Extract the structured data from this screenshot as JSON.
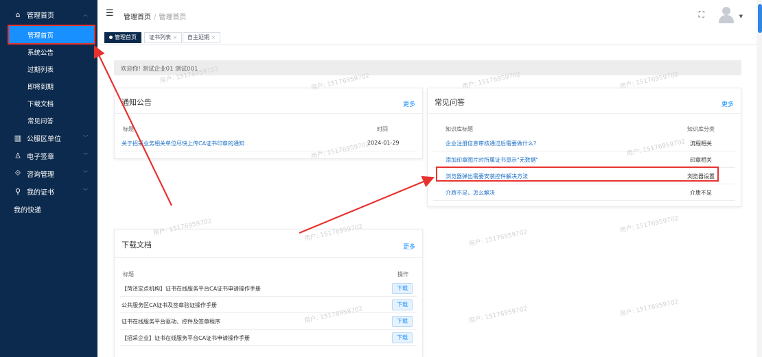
{
  "sidebar": {
    "groups": [
      {
        "label": "管理首页",
        "icon": "home-icon",
        "expanded": true,
        "items": [
          {
            "label": "管理首页",
            "active": true
          },
          {
            "label": "系统公告"
          },
          {
            "label": "过期列表"
          },
          {
            "label": "即将到期"
          },
          {
            "label": "下载文档"
          },
          {
            "label": "常见问答"
          }
        ]
      },
      {
        "label": "公服区单位",
        "icon": "building-icon"
      },
      {
        "label": "电子签章",
        "icon": "person-stamp-icon"
      },
      {
        "label": "咨询管理",
        "icon": "consult-icon"
      },
      {
        "label": "我的证书",
        "icon": "user-icon"
      }
    ],
    "leaf": {
      "label": "我的快递"
    }
  },
  "header": {
    "breadcrumb": [
      "管理首页",
      "管理首页"
    ]
  },
  "tags": [
    {
      "label": "管理首页",
      "active": true
    },
    {
      "label": "证书列表"
    },
    {
      "label": "自主延期"
    }
  ],
  "welcome": "欢迎你!  测试企业01 测试001",
  "watermark": "用户: 15176959702",
  "notice": {
    "title": "通知公告",
    "more": "更多",
    "headers": [
      "标题",
      "时间"
    ],
    "rows": [
      {
        "title": "关于招采业务相关单位尽快上传CA证书印章的通知",
        "date": "2024-01-29"
      }
    ]
  },
  "faq": {
    "title": "常见问答",
    "more": "更多",
    "headers": [
      "知识库标题",
      "知识库分类"
    ],
    "rows": [
      {
        "title": "企业注册信息审核通过后需要做什么?",
        "category": "流程相关"
      },
      {
        "title": "添加印章图片时所属证书显示\"无数据\"",
        "category": "印章相关"
      },
      {
        "title": "浏览器弹出需要安装控件解决方法",
        "category": "浏览器设置",
        "highlighted": true
      },
      {
        "title": "介质不足，怎么解决",
        "category": "介质不足"
      }
    ]
  },
  "downloads": {
    "title": "下载文档",
    "more": "更多",
    "headers": [
      "标题",
      "操作"
    ],
    "button_label": "下载",
    "rows": [
      {
        "title": "【菏泽定点机构】证书在线服务平台CA证书申请操作手册"
      },
      {
        "title": "公共服务区CA证书及签章验证操作手册"
      },
      {
        "title": "证书在线服务平台驱动、控件及签章程序"
      },
      {
        "title": "【招采企业】证书在线服务平台CA证书申请操作手册"
      }
    ]
  },
  "colors": {
    "sidebar_bg": "#0c2a4d",
    "active_item": "#1890ff",
    "annotation_red": "#e8322f",
    "link_blue": "#1c6fc6"
  }
}
